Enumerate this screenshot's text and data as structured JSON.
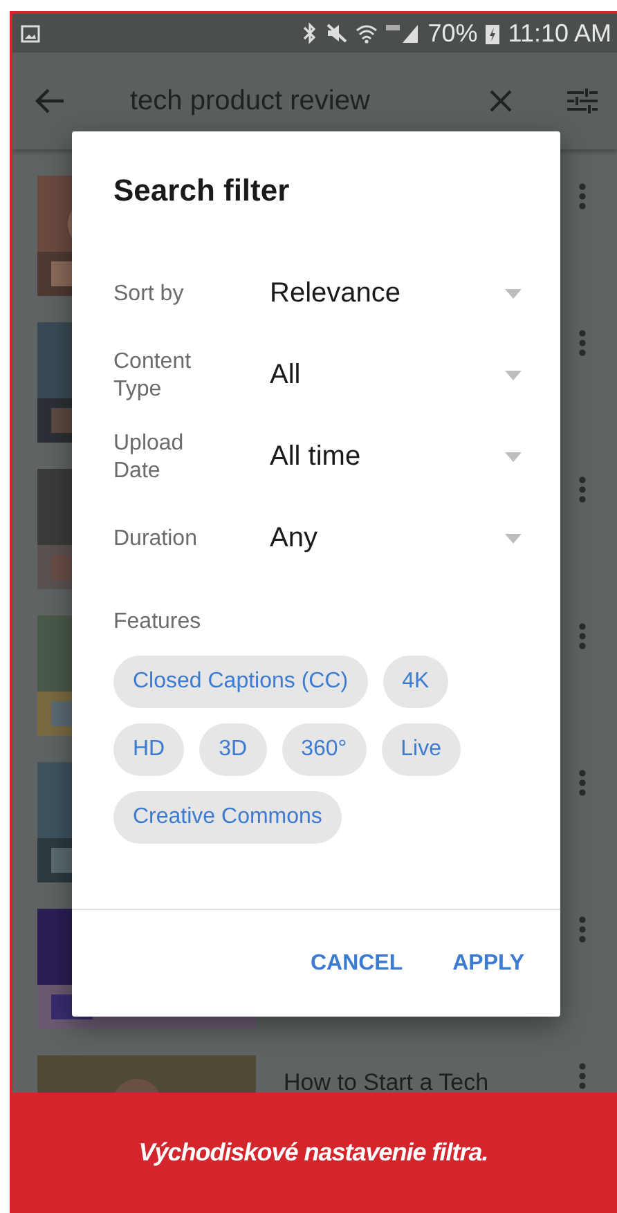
{
  "status_bar": {
    "battery": "70%",
    "time": "11:10 AM"
  },
  "app_bar": {
    "query": "tech product review"
  },
  "results": [
    {
      "thumbnail": {
        "kind": "picture"
      }
    },
    {
      "thumbnail": {
        "kind": "picture"
      }
    },
    {
      "thumbnail": {
        "kind": "picture"
      }
    },
    {
      "thumbnail": {
        "kind": "picture"
      }
    },
    {
      "thumbnail": {
        "kind": "picture"
      }
    },
    {
      "thumbnail": {
        "kind": "picture"
      }
    },
    {
      "thumbnail": {
        "kind": "picture"
      },
      "title": "How to Start a Tech"
    }
  ],
  "dialog": {
    "title": "Search filter",
    "filters": [
      {
        "label": "Sort by",
        "value": "Relevance"
      },
      {
        "label": "Content Type",
        "value": "All"
      },
      {
        "label": "Upload Date",
        "value": "All time"
      },
      {
        "label": "Duration",
        "value": "Any"
      }
    ],
    "features_label": "Features",
    "features": [
      {
        "label": "Closed Captions (CC)",
        "selected": false
      },
      {
        "label": "4K",
        "selected": false
      },
      {
        "label": "HD",
        "selected": false
      },
      {
        "label": "3D",
        "selected": false
      },
      {
        "label": "360°",
        "selected": false
      },
      {
        "label": "Live",
        "selected": false
      },
      {
        "label": "Creative Commons",
        "selected": false
      }
    ],
    "buttons": [
      "CANCEL",
      "APPLY"
    ]
  },
  "caption": "Východiskové nastavenie filtra."
}
